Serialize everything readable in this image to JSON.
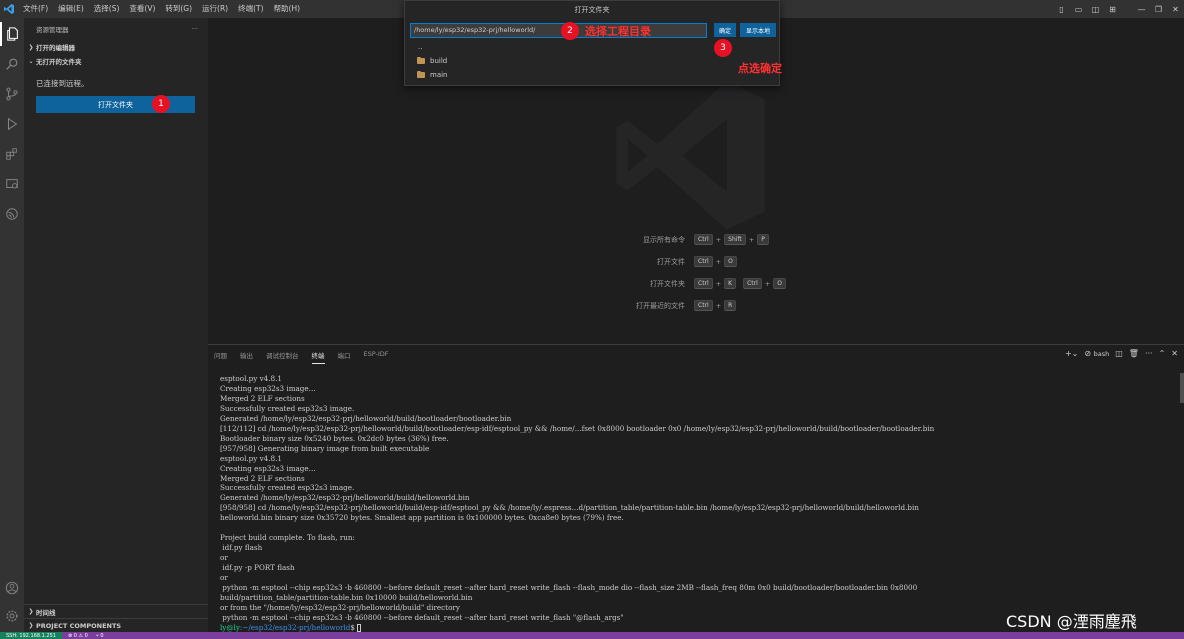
{
  "app": {
    "logo": "vscode-logo-icon",
    "menu": [
      "文件(F)",
      "编辑(E)",
      "选择(S)",
      "查看(V)",
      "转到(G)",
      "运行(R)",
      "终端(T)",
      "帮助(H)"
    ],
    "window_controls": [
      "▯",
      "▭",
      "◫",
      "⊞",
      "—",
      "❐",
      "✕"
    ]
  },
  "activity": [
    "explorer-icon",
    "search-icon",
    "source-control-icon",
    "run-debug-icon",
    "extensions-icon",
    "remote-explorer-icon",
    "esp-idf-icon",
    "account-icon",
    "settings-gear-icon"
  ],
  "sidebar": {
    "title": "资源管理器",
    "more": "···",
    "open_editors": "打开的编辑器",
    "no_folder": "无打开的文件夹",
    "connected": "已连接到远程。",
    "open_folder_button": "打开文件夹",
    "timeline": "时间线",
    "project_components": "PROJECT COMPONENTS"
  },
  "dialog": {
    "title": "打开文件夹",
    "path_value": "/home/ly/esp32/esp32-prj/helloworld/",
    "ok_button": "确定",
    "show_local_button": "显示本地",
    "items": [
      "..",
      "build",
      "main"
    ]
  },
  "annotations": {
    "badge1": "1",
    "badge2": "2",
    "badge3": "3",
    "note2": "选择工程目录",
    "note3": "点选确定"
  },
  "shortcuts": [
    {
      "label": "显示所有命令",
      "keys": [
        "Ctrl",
        "+",
        "Shift",
        "+",
        "P"
      ]
    },
    {
      "label": "打开文件",
      "keys": [
        "Ctrl",
        "+",
        "O"
      ]
    },
    {
      "label": "打开文件夹",
      "keys": [
        "Ctrl",
        "+",
        "K",
        "Ctrl",
        "+",
        "O"
      ]
    },
    {
      "label": "打开最近的文件",
      "keys": [
        "Ctrl",
        "+",
        "R"
      ]
    }
  ],
  "panel": {
    "tabs": [
      "问题",
      "输出",
      "调试控制台",
      "终端",
      "端口",
      "ESP-IDF"
    ],
    "active_tab": 3,
    "shell": "bash",
    "terminal_lines": [
      "esptool.py v4.8.1",
      "Creating esp32s3 image...",
      "Merged 2 ELF sections",
      "Successfully created esp32s3 image.",
      "Generated /home/ly/esp32/esp32-prj/helloworld/build/bootloader/bootloader.bin",
      "[112/112] cd /home/ly/esp32/esp32-prj/helloworld/build/bootloader/esp-idf/esptool_py && /home/...fset 0x8000 bootloader 0x0 /home/ly/esp32/esp32-prj/helloworld/build/bootloader/bootloader.bin",
      "Bootloader binary size 0x5240 bytes. 0x2dc0 bytes (36%) free.",
      "[957/958] Generating binary image from built executable",
      "esptool.py v4.8.1",
      "Creating esp32s3 image...",
      "Merged 2 ELF sections",
      "Successfully created esp32s3 image.",
      "Generated /home/ly/esp32/esp32-prj/helloworld/build/helloworld.bin",
      "[958/958] cd /home/ly/esp32/esp32-prj/helloworld/build/esp-idf/esptool_py && /home/ly/.espress...d/partition_table/partition-table.bin /home/ly/esp32/esp32-prj/helloworld/build/helloworld.bin",
      "helloworld.bin binary size 0x35720 bytes. Smallest app partition is 0x100000 bytes. 0xca8e0 bytes (79%) free.",
      "",
      "Project build complete. To flash, run:",
      " idf.py flash",
      "or",
      " idf.py -p PORT flash",
      "or",
      " python -m esptool --chip esp32s3 -b 460800 --before default_reset --after hard_reset write_flash --flash_mode dio --flash_size 2MB --flash_freq 80m 0x0 build/bootloader/bootloader.bin 0x8000",
      "build/partition_table/partition-table.bin 0x10000 build/helloworld.bin",
      "or from the \"/home/ly/esp32/esp32-prj/helloworld/build\" directory",
      " python -m esptool --chip esp32s3 -b 460800 --before default_reset --after hard_reset write_flash \"@flash_args\""
    ],
    "prompt_user": "ly@ly",
    "prompt_path": ":~/esp32/esp32-prj/helloworld",
    "prompt_symbol": "$ "
  },
  "statusbar": {
    "remote": "SSH: 192.168.1.251",
    "items": [
      "⊗ 0 ⚠ 0",
      "⑂ 0"
    ]
  },
  "watermark_text": "CSDN @湮雨塵飛"
}
